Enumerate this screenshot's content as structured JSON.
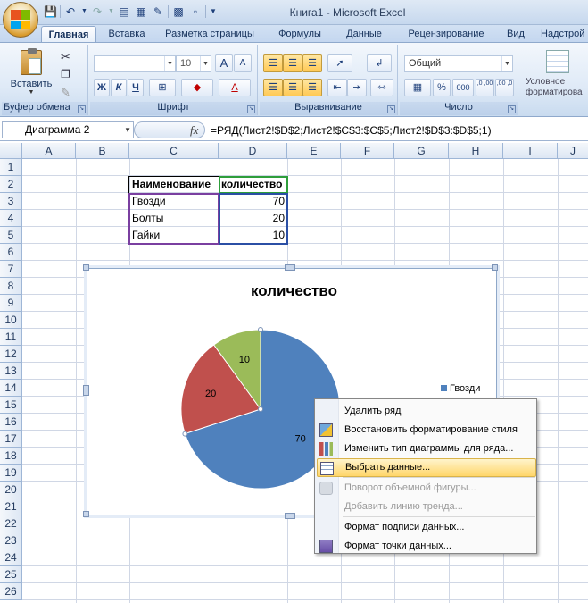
{
  "window": {
    "title": "Книга1 - Microsoft Excel"
  },
  "tabs": [
    "Главная",
    "Вставка",
    "Разметка страницы",
    "Формулы",
    "Данные",
    "Рецензирование",
    "Вид",
    "Надстрой"
  ],
  "ribbon": {
    "clipboard": {
      "label": "Буфер обмена",
      "paste_label": "Вставить"
    },
    "font": {
      "label": "Шрифт",
      "font_name": "",
      "font_size": "10",
      "bold": "Ж",
      "italic": "К",
      "underline": "Ч",
      "grow": "A",
      "shrink": "A"
    },
    "alignment": {
      "label": "Выравнивание"
    },
    "number": {
      "label": "Число",
      "format": "Общий",
      "percent": "%",
      "thousands": "000",
      "inc_decimal": ",0 ,00",
      "dec_decimal": ",00 ,0"
    },
    "styles": {
      "label": "Условное форматирова"
    }
  },
  "formula_bar": {
    "name_box": "Диаграмма 2",
    "fx": "fx",
    "formula": "=РЯД(Лист2!$D$2;Лист2!$C$3:$C$5;Лист2!$D$3:$D$5;1)"
  },
  "columns": [
    "A",
    "B",
    "C",
    "D",
    "E",
    "F",
    "G",
    "H",
    "I",
    "J"
  ],
  "rows": [
    "1",
    "2",
    "3",
    "4",
    "5",
    "6",
    "7",
    "8",
    "9",
    "10",
    "11",
    "12",
    "13",
    "14",
    "15",
    "16",
    "17",
    "18",
    "19",
    "20",
    "21",
    "22",
    "23",
    "24",
    "25",
    "26"
  ],
  "table": {
    "header": [
      "Наименование",
      "количество"
    ],
    "rows": [
      [
        "Гвозди",
        "70"
      ],
      [
        "Болты",
        "20"
      ],
      [
        "Гайки",
        "10"
      ]
    ]
  },
  "chart_data": {
    "type": "pie",
    "title": "количество",
    "categories": [
      "Гвозди",
      "Болты",
      "Гайки"
    ],
    "values": [
      70,
      20,
      10
    ],
    "data_labels": [
      "70",
      "20",
      "10"
    ],
    "colors": [
      "#4f81bd",
      "#c0504d",
      "#9bbb59"
    ],
    "legend_visible": [
      "Гвозди"
    ],
    "legend_position": "right"
  },
  "context_menu": {
    "items": [
      {
        "label": "Удалить ряд",
        "icon": "",
        "disabled": false,
        "highlight": false
      },
      {
        "label": "Восстановить форматирование стиля",
        "icon": "reset-style-icon",
        "disabled": false,
        "highlight": false
      },
      {
        "label": "Изменить тип диаграммы для ряда...",
        "icon": "chart-type-icon",
        "disabled": false,
        "highlight": false
      },
      {
        "label": "Выбрать данные...",
        "icon": "select-data-icon",
        "disabled": false,
        "highlight": true
      },
      {
        "label": "Поворот объемной фигуры...",
        "icon": "rotate-3d-icon",
        "disabled": true,
        "highlight": false
      },
      {
        "label": "Добавить линию тренда...",
        "icon": "",
        "disabled": true,
        "highlight": false
      },
      {
        "label": "Формат подписи данных...",
        "icon": "",
        "disabled": false,
        "highlight": false
      },
      {
        "label": "Формат точки данных...",
        "icon": "format-point-icon",
        "disabled": false,
        "highlight": false
      }
    ]
  }
}
